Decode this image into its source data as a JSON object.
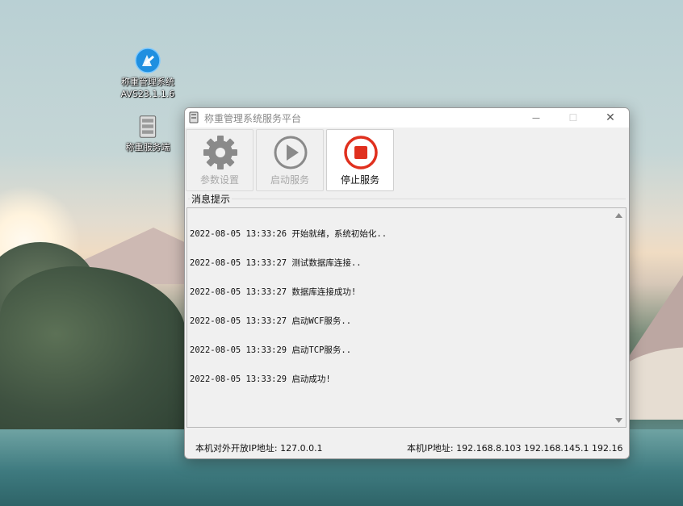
{
  "desktop": {
    "icons": [
      {
        "name": "称重管理系统",
        "subtitle": "AVS23.1.1.6"
      },
      {
        "name": "称重服务端"
      }
    ]
  },
  "window": {
    "title": "称重管理系统服务平台",
    "controls": {
      "minimize": "—",
      "maximize": "☐",
      "close": "✕"
    },
    "toolbar": {
      "settings_label": "参数设置",
      "start_label": "启动服务",
      "stop_label": "停止服务"
    },
    "group_label": "消息提示",
    "log": [
      "2022-08-05 13:33:26 开始就绪，系统初始化..",
      "2022-08-05 13:33:27 测试数据库连接..",
      "2022-08-05 13:33:27 数据库连接成功!",
      "2022-08-05 13:33:27 启动WCF服务..",
      "2022-08-05 13:33:29 启动TCP服务..",
      "2022-08-05 13:33:29 启动成功!"
    ],
    "status": {
      "open_ip": "本机对外开放IP地址: 127.0.0.1",
      "local_ip": "本机IP地址: 192.168.8.103 192.168.145.1 192.16"
    },
    "colors": {
      "stop_red": "#e0301e",
      "disabled_gray": "#8a8a8a"
    }
  }
}
